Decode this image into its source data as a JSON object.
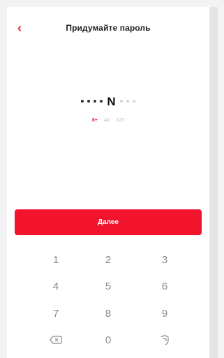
{
  "header": {
    "back_icon": "chevron-left-icon",
    "title": "Придумайте пароль"
  },
  "password": {
    "masked_before": 4,
    "visible_char": "N",
    "masked_after": 3
  },
  "rules": [
    {
      "label": "8+",
      "active": true
    },
    {
      "label": "Aa",
      "active": false
    },
    {
      "label": "123",
      "active": false
    }
  ],
  "next_label": "Далее",
  "keypad": {
    "keys": [
      "1",
      "2",
      "3",
      "4",
      "5",
      "6",
      "7",
      "8",
      "9",
      "",
      "0",
      ""
    ],
    "backspace_icon": "backspace-icon",
    "fingerprint_icon": "fingerprint-icon"
  },
  "colors": {
    "accent": "#f2132d",
    "back": "#e8213b"
  }
}
